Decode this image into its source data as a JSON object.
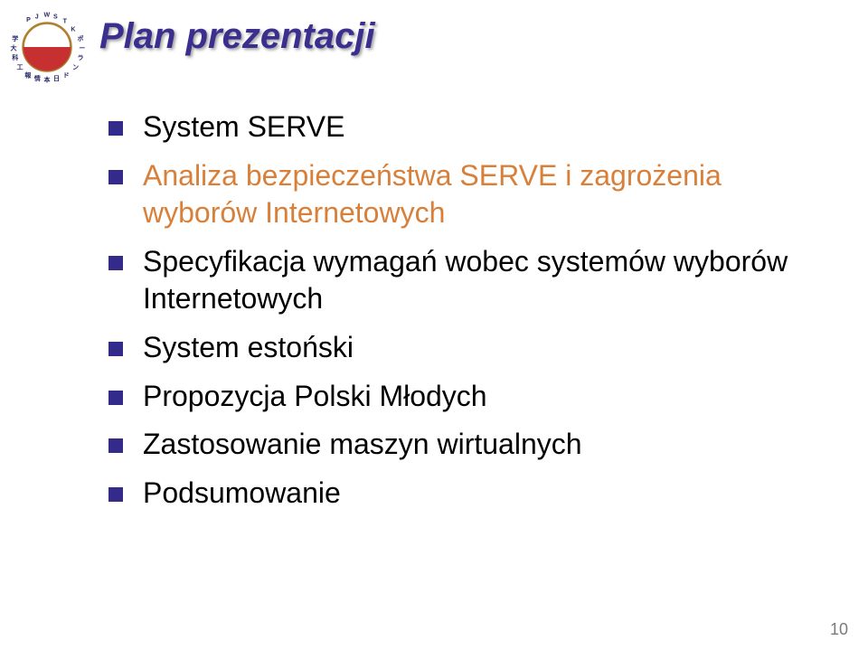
{
  "title": "Plan prezentacji",
  "bullets": [
    {
      "text": "System SERVE",
      "highlight": false
    },
    {
      "text": "Analiza bezpieczeństwa SERVE i zagrożenia wyborów Internetowych",
      "highlight": true
    },
    {
      "text": "Specyfikacja wymagań wobec systemów wyborów Internetowych",
      "highlight": false
    },
    {
      "text": "System estoński",
      "highlight": false
    },
    {
      "text": "Propozycja Polski Młodych",
      "highlight": false
    },
    {
      "text": "Zastosowanie maszyn wirtualnych",
      "highlight": false
    },
    {
      "text": "Podsumowanie",
      "highlight": false
    }
  ],
  "page_number": "10"
}
